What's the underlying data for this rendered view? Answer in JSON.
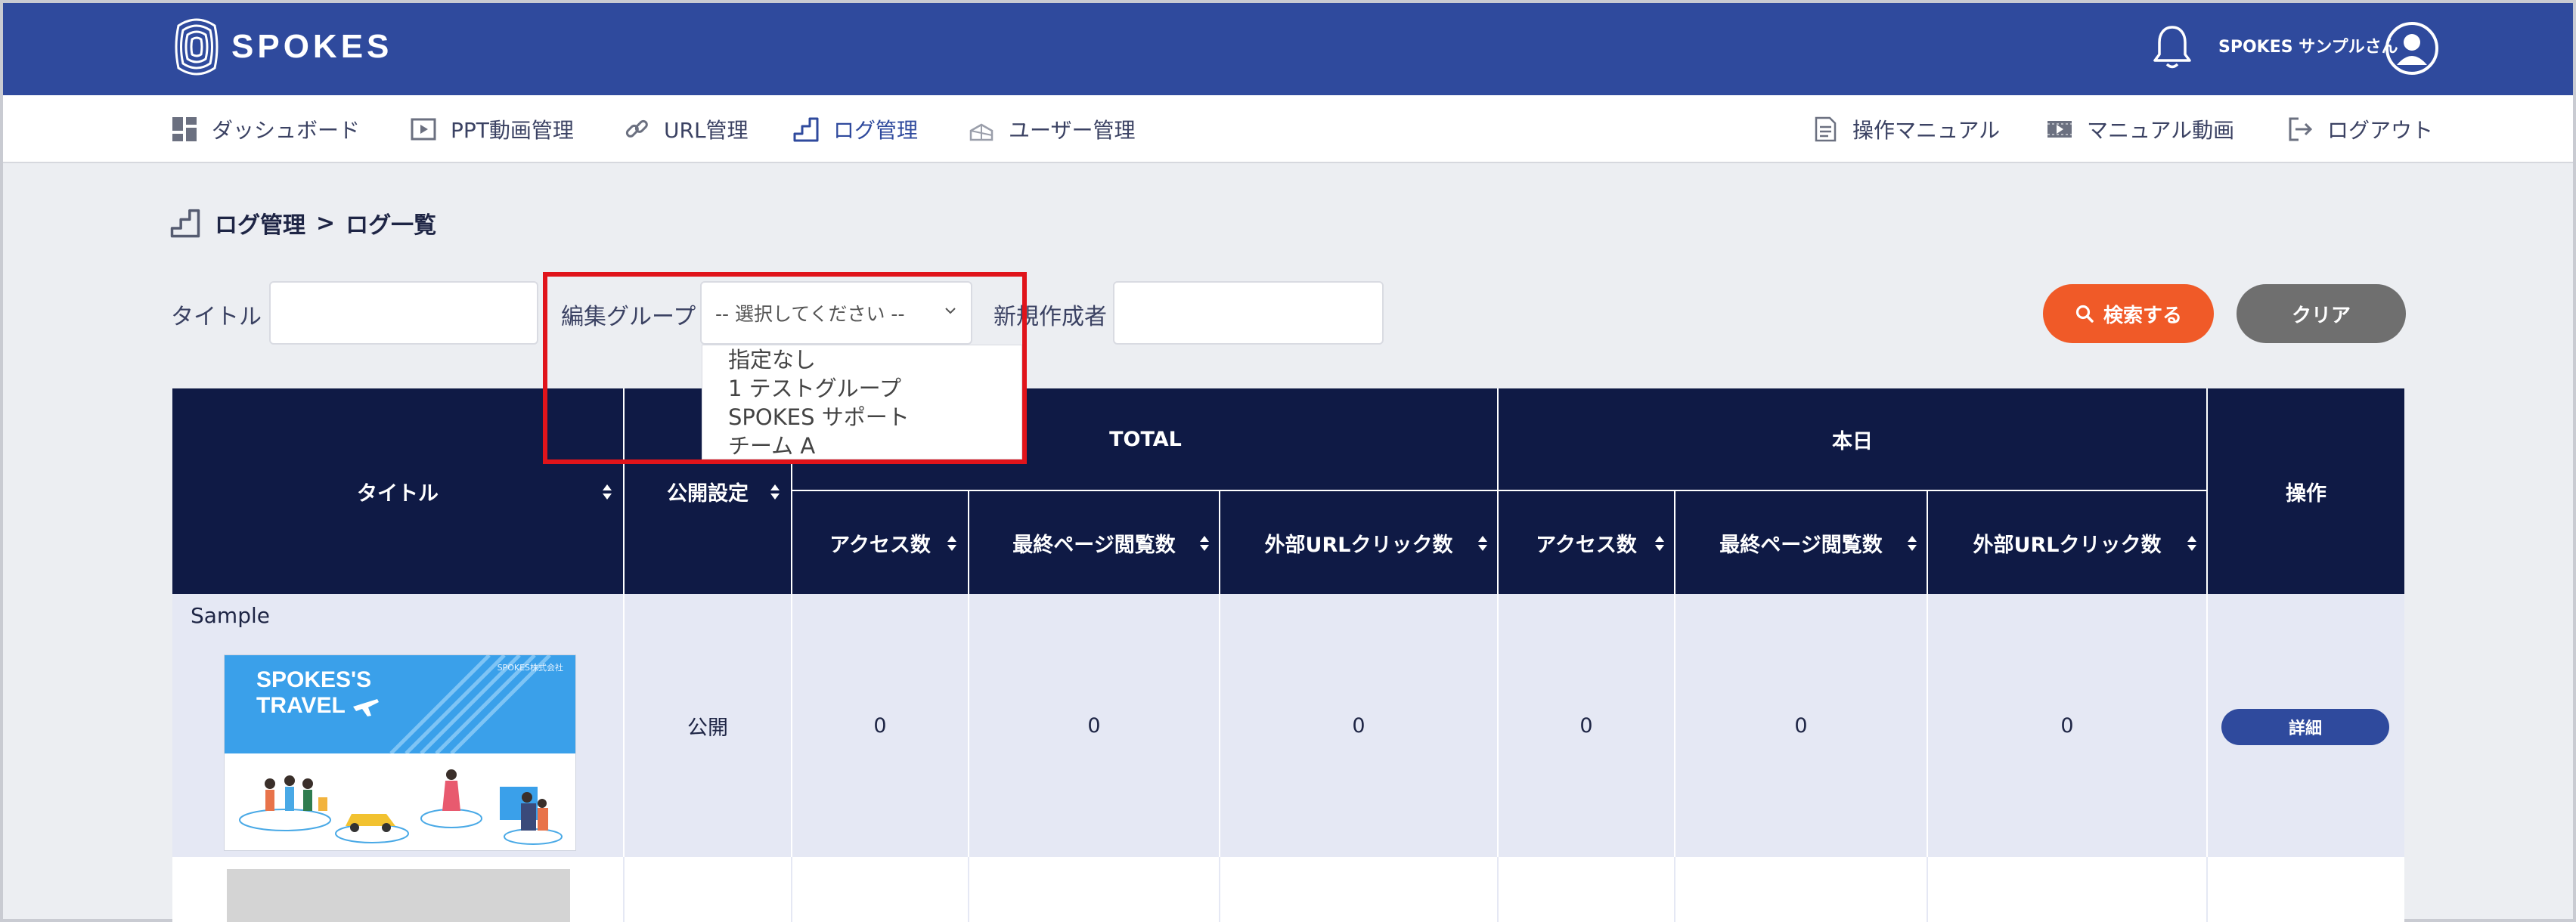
{
  "header": {
    "logo_text": "SPOKES",
    "user_name": "SPOKES サンプルさん"
  },
  "nav": {
    "left": [
      {
        "label": "ダッシュボード",
        "icon": "dashboard-icon"
      },
      {
        "label": "PPT動画管理",
        "icon": "ppt-video-icon"
      },
      {
        "label": "URL管理",
        "icon": "link-icon"
      },
      {
        "label": "ログ管理",
        "icon": "stairs-icon",
        "active": true
      },
      {
        "label": "ユーザー管理",
        "icon": "users-icon"
      }
    ],
    "right": [
      {
        "label": "操作マニュアル",
        "icon": "document-icon"
      },
      {
        "label": "マニュアル動画",
        "icon": "video-icon"
      },
      {
        "label": "ログアウト",
        "icon": "logout-icon"
      }
    ]
  },
  "breadcrumb": {
    "parent": "ログ管理",
    "separator": ">",
    "current": "ログ一覧"
  },
  "filters": {
    "title_label": "タイトル",
    "title_value": "",
    "group_label": "編集グループ",
    "group_selected": "-- 選択してください --",
    "group_options": [
      "指定なし",
      "1 テストグループ",
      "SPOKES サポート",
      "チーム A"
    ],
    "creator_label": "新規作成者",
    "creator_value": "",
    "search_button": "検索する",
    "clear_button": "クリア"
  },
  "table": {
    "headers": {
      "title": "タイトル",
      "public": "公開設定",
      "total_group": "TOTAL",
      "today_group": "本日",
      "action": "操作",
      "total_cols": [
        "アクセス数",
        "最終ページ閲覧数",
        "外部URLクリック数"
      ],
      "today_cols": [
        "アクセス数",
        "最終ページ閲覧数",
        "外部URLクリック数"
      ]
    },
    "rows": [
      {
        "title": "Sample",
        "thumbnail_title_line1": "SPOKES'S",
        "thumbnail_title_line2": "TRAVEL",
        "thumbnail_company": "SPOKES株式会社",
        "public": "公開",
        "total": [
          "0",
          "0",
          "0"
        ],
        "today": [
          "0",
          "0",
          "0"
        ],
        "action": "詳細"
      }
    ]
  },
  "colors": {
    "header_bg": "#2f4a9d",
    "table_head_bg": "#0f1a45",
    "search_button": "#f05a28",
    "clear_button": "#6f6f6f",
    "highlight_box": "#e0141b"
  }
}
